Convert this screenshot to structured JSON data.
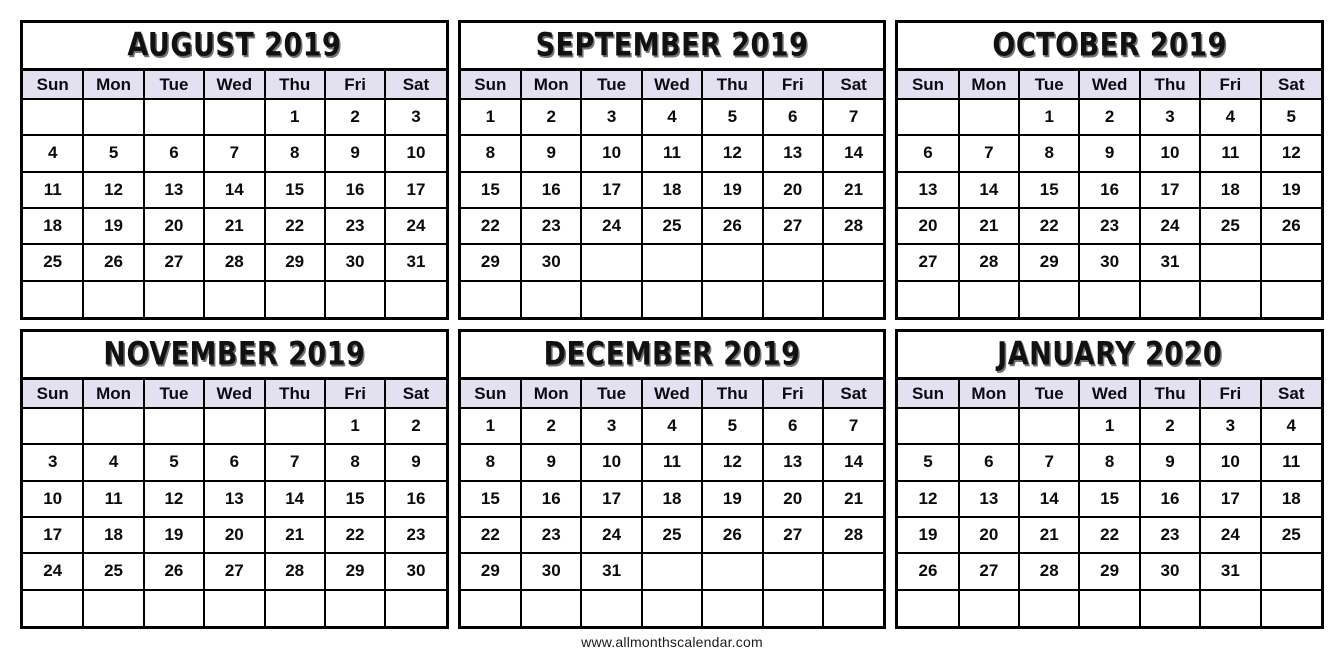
{
  "page": {
    "weekday_headers": [
      "Sun",
      "Mon",
      "Tue",
      "Wed",
      "Thu",
      "Fri",
      "Sat"
    ],
    "footer_url": "www.allmonthscalendar.com",
    "header_bg_color": "#e3e1ef",
    "border_color": "#000000",
    "text_color": "#0b0b0b",
    "page_bg_color": "#ffffff"
  },
  "months": [
    {
      "id": "august-2019",
      "title": "AUGUST 2019",
      "month_name": "August",
      "year": "2019",
      "first_weekday": "Thu",
      "days_in_month": 31,
      "weeks": [
        [
          "",
          "",
          "",
          "",
          "1",
          "2",
          "3"
        ],
        [
          "4",
          "5",
          "6",
          "7",
          "8",
          "9",
          "10"
        ],
        [
          "11",
          "12",
          "13",
          "14",
          "15",
          "16",
          "17"
        ],
        [
          "18",
          "19",
          "20",
          "21",
          "22",
          "23",
          "24"
        ],
        [
          "25",
          "26",
          "27",
          "28",
          "29",
          "30",
          "31"
        ],
        [
          "",
          "",
          "",
          "",
          "",
          "",
          ""
        ]
      ]
    },
    {
      "id": "september-2019",
      "title": "SEPTEMBER 2019",
      "month_name": "September",
      "year": "2019",
      "first_weekday": "Sun",
      "days_in_month": 30,
      "weeks": [
        [
          "1",
          "2",
          "3",
          "4",
          "5",
          "6",
          "7"
        ],
        [
          "8",
          "9",
          "10",
          "11",
          "12",
          "13",
          "14"
        ],
        [
          "15",
          "16",
          "17",
          "18",
          "19",
          "20",
          "21"
        ],
        [
          "22",
          "23",
          "24",
          "25",
          "26",
          "27",
          "28"
        ],
        [
          "29",
          "30",
          "",
          "",
          "",
          "",
          ""
        ],
        [
          "",
          "",
          "",
          "",
          "",
          "",
          ""
        ]
      ]
    },
    {
      "id": "october-2019",
      "title": "OCTOBER 2019",
      "month_name": "October",
      "year": "2019",
      "first_weekday": "Tue",
      "days_in_month": 31,
      "weeks": [
        [
          "",
          "",
          "1",
          "2",
          "3",
          "4",
          "5"
        ],
        [
          "6",
          "7",
          "8",
          "9",
          "10",
          "11",
          "12"
        ],
        [
          "13",
          "14",
          "15",
          "16",
          "17",
          "18",
          "19"
        ],
        [
          "20",
          "21",
          "22",
          "23",
          "24",
          "25",
          "26"
        ],
        [
          "27",
          "28",
          "29",
          "30",
          "31",
          "",
          ""
        ],
        [
          "",
          "",
          "",
          "",
          "",
          "",
          ""
        ]
      ]
    },
    {
      "id": "november-2019",
      "title": "NOVEMBER 2019",
      "month_name": "November",
      "year": "2019",
      "first_weekday": "Fri",
      "days_in_month": 30,
      "weeks": [
        [
          "",
          "",
          "",
          "",
          "",
          "1",
          "2"
        ],
        [
          "3",
          "4",
          "5",
          "6",
          "7",
          "8",
          "9"
        ],
        [
          "10",
          "11",
          "12",
          "13",
          "14",
          "15",
          "16"
        ],
        [
          "17",
          "18",
          "19",
          "20",
          "21",
          "22",
          "23"
        ],
        [
          "24",
          "25",
          "26",
          "27",
          "28",
          "29",
          "30"
        ],
        [
          "",
          "",
          "",
          "",
          "",
          "",
          ""
        ]
      ]
    },
    {
      "id": "december-2019",
      "title": "DECEMBER 2019",
      "month_name": "December",
      "year": "2019",
      "first_weekday": "Sun",
      "days_in_month": 31,
      "weeks": [
        [
          "1",
          "2",
          "3",
          "4",
          "5",
          "6",
          "7"
        ],
        [
          "8",
          "9",
          "10",
          "11",
          "12",
          "13",
          "14"
        ],
        [
          "15",
          "16",
          "17",
          "18",
          "19",
          "20",
          "21"
        ],
        [
          "22",
          "23",
          "24",
          "25",
          "26",
          "27",
          "28"
        ],
        [
          "29",
          "30",
          "31",
          "",
          "",
          "",
          ""
        ],
        [
          "",
          "",
          "",
          "",
          "",
          "",
          ""
        ]
      ]
    },
    {
      "id": "january-2020",
      "title": "JANUARY 2020",
      "month_name": "January",
      "year": "2020",
      "first_weekday": "Wed",
      "days_in_month": 31,
      "weeks": [
        [
          "",
          "",
          "",
          "1",
          "2",
          "3",
          "4"
        ],
        [
          "5",
          "6",
          "7",
          "8",
          "9",
          "10",
          "11"
        ],
        [
          "12",
          "13",
          "14",
          "15",
          "16",
          "17",
          "18"
        ],
        [
          "19",
          "20",
          "21",
          "22",
          "23",
          "24",
          "25"
        ],
        [
          "26",
          "27",
          "28",
          "29",
          "30",
          "31",
          ""
        ],
        [
          "",
          "",
          "",
          "",
          "",
          "",
          ""
        ]
      ]
    }
  ]
}
